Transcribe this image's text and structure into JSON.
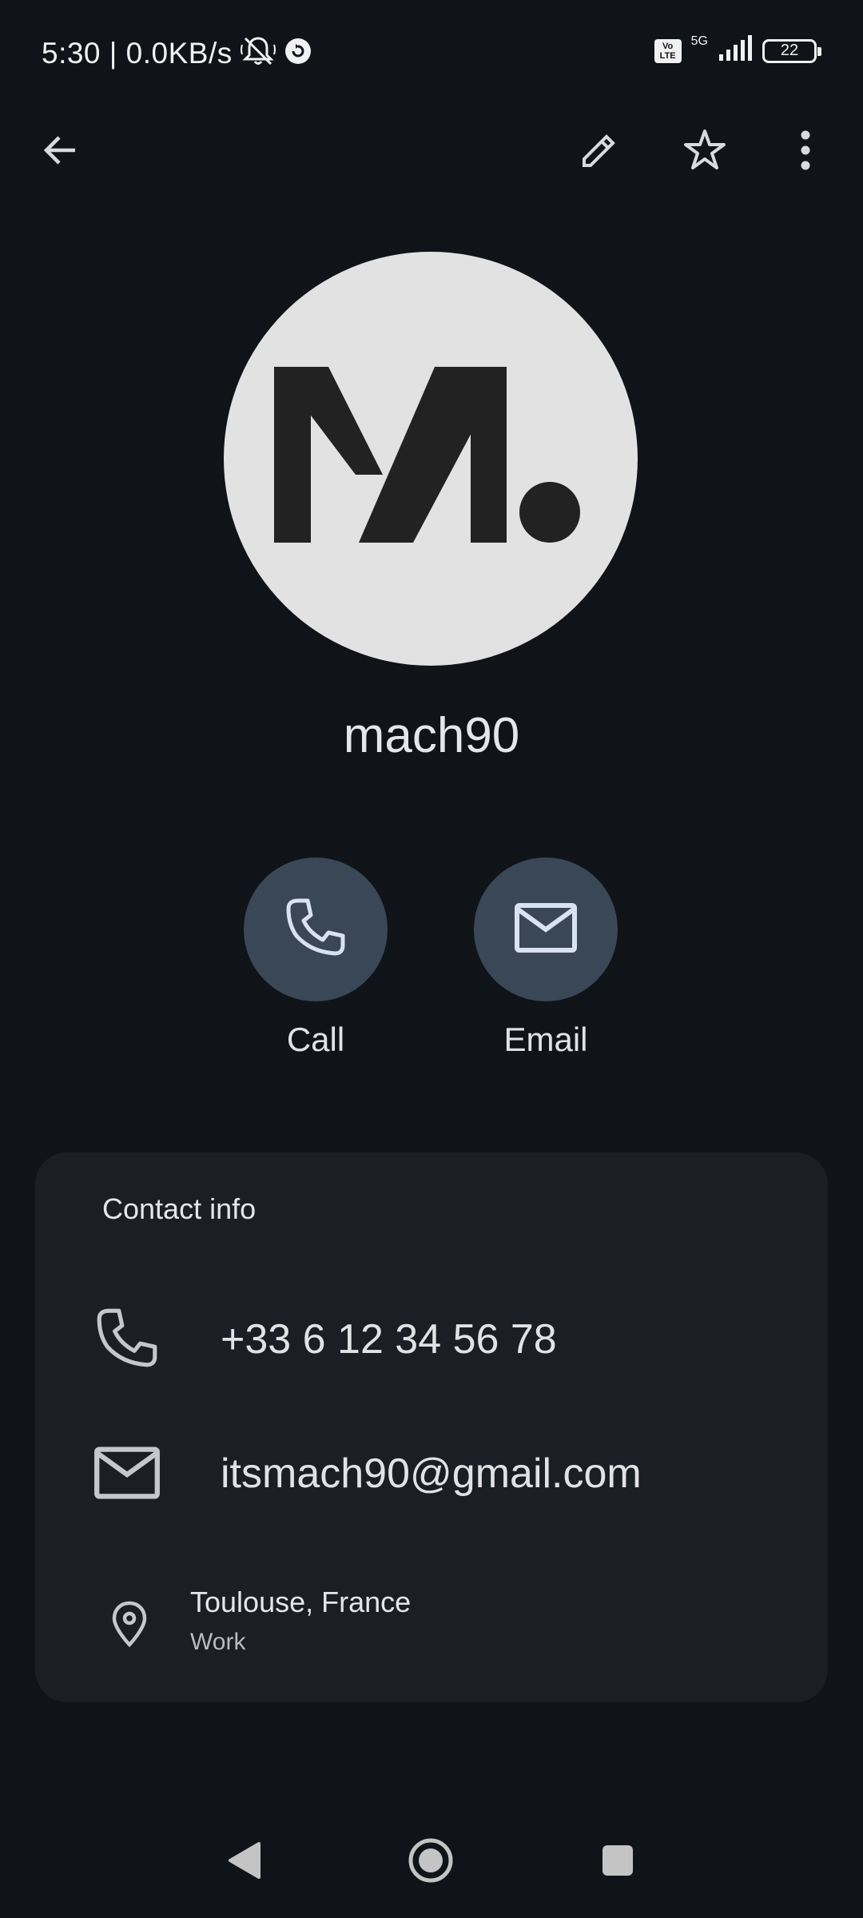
{
  "status_bar": {
    "time_text": "5:30 | 0.0KB/s",
    "volte_label": "Vo\nLTE",
    "network_label": "5G",
    "battery_level": "22",
    "icons": [
      "bell-off-icon",
      "sync-icon",
      "volte-icon",
      "signal-icon",
      "battery-icon"
    ]
  },
  "top_bar": {
    "icons": [
      "back-arrow-icon",
      "edit-pencil-icon",
      "star-outline-icon",
      "more-vert-icon"
    ]
  },
  "contact": {
    "name": "mach90",
    "avatar_logo": "M."
  },
  "actions": {
    "call_label": "Call",
    "email_label": "Email"
  },
  "contact_info": {
    "title": "Contact info",
    "phone": "+33 6 12 34 56 78",
    "email": "itsmach90@gmail.com",
    "address": "Toulouse, France",
    "address_type": "Work"
  },
  "navigation_bar": {
    "icons": [
      "nav-back-icon",
      "nav-home-icon",
      "nav-recents-icon"
    ]
  },
  "colors": {
    "background": "#101418",
    "card": "#1b1f25",
    "action_button": "#3a4757",
    "avatar_bg": "#e2e2e2",
    "text_primary": "#e2e2e6"
  }
}
